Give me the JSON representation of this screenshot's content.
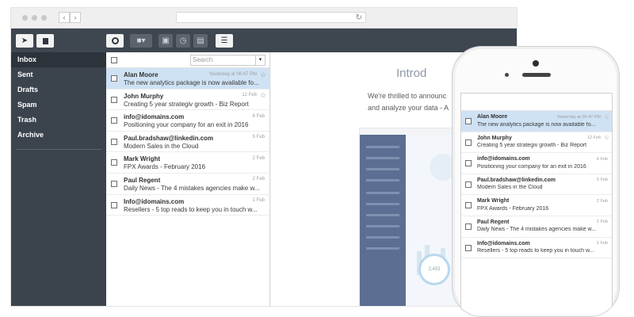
{
  "toolbar": {
    "compose_icon": "paper-plane-icon",
    "contacts_icon": "contact-card-icon",
    "refresh_icon": "refresh-circle-icon",
    "move_icon": "folder-dropdown-icon",
    "archive_icon": "archive-box-icon",
    "snooze_icon": "clock-icon",
    "delete_icon": "trash-icon",
    "more_icon": "menu-lines-icon"
  },
  "sidebar": {
    "items": [
      {
        "label": "Inbox"
      },
      {
        "label": "Sent"
      },
      {
        "label": "Drafts"
      },
      {
        "label": "Spam"
      },
      {
        "label": "Trash"
      },
      {
        "label": "Archive"
      }
    ]
  },
  "mail_list": {
    "search_placeholder": "Search",
    "messages": [
      {
        "sender": "Alan Moore",
        "date": "Yesterday at 06:47 PM",
        "subject": "The new analytics package is now available fo...",
        "starred": true,
        "selected": true
      },
      {
        "sender": "John Murphy",
        "date": "12 Feb",
        "subject": "Creating 5 year strategiv growth - Biz Report",
        "starred": true,
        "selected": false
      },
      {
        "sender": "info@idomains.com",
        "date": "6 Feb",
        "subject": "Positioning your company for an exit in 2016",
        "starred": false,
        "selected": false
      },
      {
        "sender": "Paul.bradshaw@linkedin.com",
        "date": "5 Feb",
        "subject": "Modern Sales in the Cloud",
        "starred": false,
        "selected": false
      },
      {
        "sender": "Mark Wright",
        "date": "2 Feb",
        "subject": "FPX Awards - February 2016",
        "starred": false,
        "selected": false
      },
      {
        "sender": "Paul Regent",
        "date": "2 Feb",
        "subject": "Daily News - The 4 mistakes agencies make w...",
        "starred": false,
        "selected": false
      },
      {
        "sender": "Info@idomains.com",
        "date": "1 Feb",
        "subject": "Resellers - 5 top reads to keep you in touch w...",
        "starred": false,
        "selected": false
      }
    ]
  },
  "reading_pane": {
    "title": "Introd",
    "line1": "We're thrilled to announc",
    "line2": "and analyze your data - A",
    "preview_stat": "2,453"
  },
  "colors": {
    "sidebar": "#3b434d",
    "toolbar": "#3e4650",
    "selected_row": "#cfe2f4"
  }
}
